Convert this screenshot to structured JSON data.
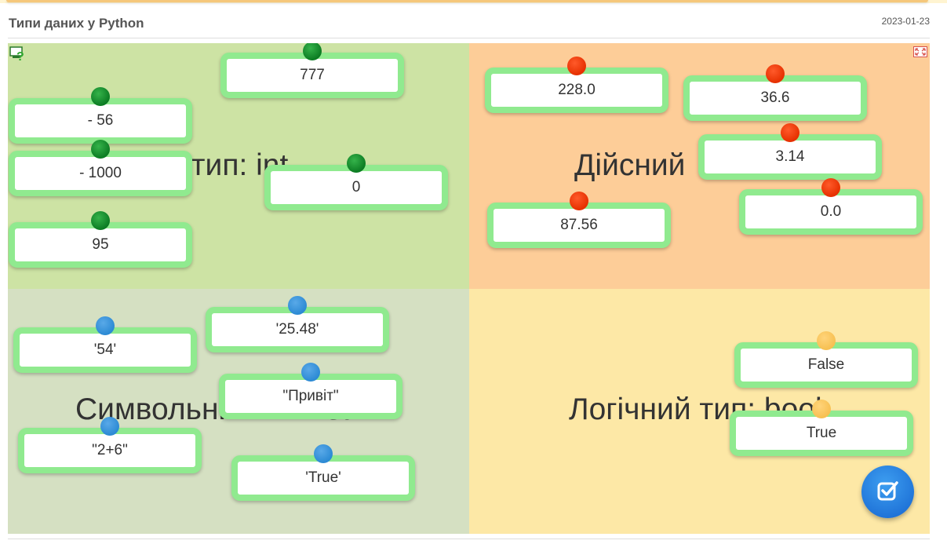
{
  "header": {
    "title": "Типи даних у Python",
    "date": "2023-01-23"
  },
  "categories": {
    "int": "Цілий тип: int",
    "float": "Дійсний",
    "str": "Символьний тип: str",
    "bool": "Логічний тип: bool"
  },
  "cards": {
    "c777": "777",
    "cm56": "- 56",
    "cm1000": "- 1000",
    "c0": "0",
    "c95": "95",
    "c228": "228.0",
    "c366": "36.6",
    "c314": "3.14",
    "c00": "0.0",
    "c8756": "87.56",
    "s2548": "'25.48'",
    "s54": "'54'",
    "sprivit": "\"Привіт\"",
    "s26": "\"2+6\"",
    "strue": "'True'",
    "bfalse": "False",
    "btrue": "True"
  },
  "icons": {
    "help": "help-icon",
    "expand": "expand-icon",
    "check": "check-icon"
  },
  "colors": {
    "int_pin": "#0c7c23",
    "float_pin": "#e63000",
    "str_pin": "#2c8ad4",
    "bool_pin": "#f7c052",
    "card_border": "#90ea8f",
    "check_button": "#1f73d8"
  }
}
